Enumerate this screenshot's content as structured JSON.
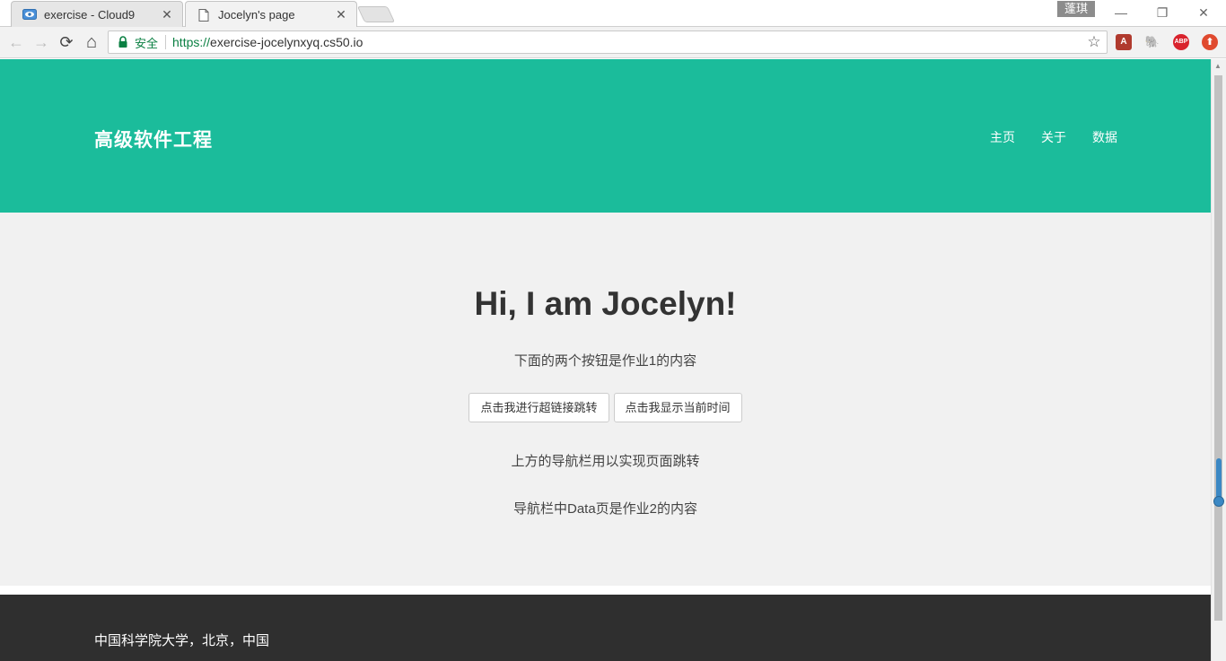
{
  "browser": {
    "tabs": [
      {
        "title": "exercise - Cloud9",
        "active": false,
        "icon": "cloud9-eye-icon"
      },
      {
        "title": "Jocelyn's page",
        "active": true,
        "icon": "page-icon"
      }
    ],
    "tab_close_glyph": "✕",
    "ime_badge": "蓬琪",
    "window_controls": {
      "minimize": "—",
      "restore": "❐",
      "close": "✕"
    },
    "nav": {
      "back": "←",
      "forward": "→",
      "reload": "⟳",
      "home": "⌂"
    },
    "address": {
      "secure_label": "安全",
      "url_scheme": "https://",
      "url_host": "exercise-jocelynxyq.cs50.io"
    },
    "bookmark_glyph": "☆",
    "extensions": [
      {
        "name": "acrobat-extension-icon",
        "label": "A",
        "color": "#b03a2e"
      },
      {
        "name": "evernote-extension-icon",
        "label": "🐘",
        "color": "#555555"
      },
      {
        "name": "adblock-plus-extension-icon",
        "label": "ABP",
        "color": "#d9232d"
      },
      {
        "name": "upload-extension-icon",
        "label": "⬆",
        "color": "#e04a2f"
      }
    ]
  },
  "page": {
    "brand": "高级软件工程",
    "nav_links": [
      "主页",
      "关于",
      "数据"
    ],
    "hero": {
      "title": "Hi, I am Jocelyn!",
      "intro": "下面的两个按钮是作业1的内容",
      "buttons": [
        "点击我进行超链接跳转",
        "点击我显示当前时间"
      ],
      "line2": "上方的导航栏用以实现页面跳转",
      "line3": "导航栏中Data页是作业2的内容"
    },
    "footer": "中国科学院大学，北京，中国"
  },
  "colors": {
    "navbar_bg": "#1bbc9b",
    "hero_bg": "#f1f1f1",
    "footer_bg": "#2f2f2f",
    "secure_green": "#0b8043"
  }
}
